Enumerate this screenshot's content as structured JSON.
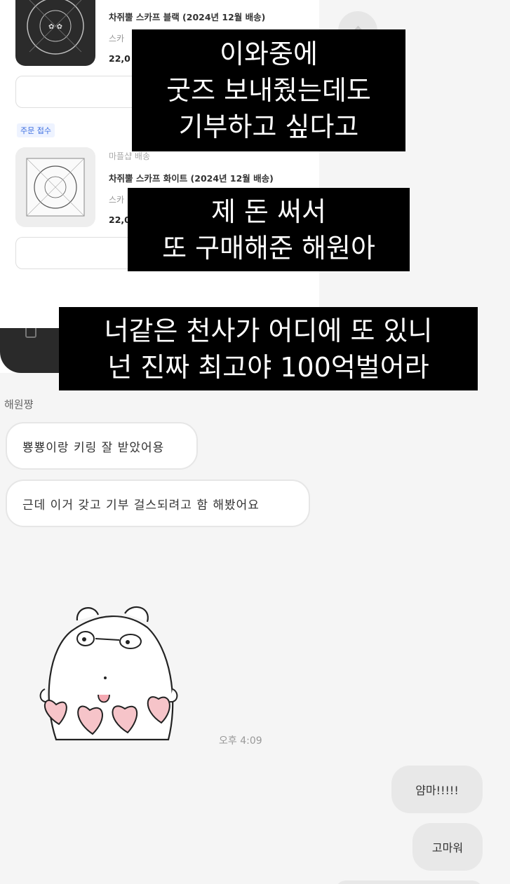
{
  "shop": {
    "order_status": "주문 접수",
    "products": [
      {
        "seller": "",
        "name": "차쥐뿔 스카프 블랙 (2024년 12월 배송)",
        "option": "스카",
        "price": "22,0",
        "thumb_color": "#2b2b2b"
      },
      {
        "seller": "마플샵 배송",
        "name": "차쥐뿔 스카프 화이트 (2024년 12월 배송)",
        "option": "스카",
        "price": "22,0",
        "thumb_color": "#f1f1f1"
      }
    ]
  },
  "captions": {
    "first": [
      "이와중에",
      "굿즈 보내줬는데도",
      "기부하고 싶다고"
    ],
    "second": [
      "제 돈 써서",
      "또 구매해준 해원아"
    ],
    "third": [
      "너같은 천사가 어디에 또 있니",
      "넌 진짜 최고야 100억벌어라"
    ]
  },
  "chat": {
    "sender_name": "해원쨩",
    "incoming": [
      "뿅뿅이랑 키링 잘 받았어용",
      "근데 이거 갖고 기부 걸스되려고 함 해봤어요"
    ],
    "sticker": "bear-hearts-sticker",
    "timestamp": "오후 4:09",
    "outgoing": [
      "얌마!!!!!",
      "고마워",
      ""
    ]
  },
  "colors": {
    "caption_bg": "#000000",
    "incoming_bubble": "#ffffff",
    "outgoing_bubble": "#e8e8e8",
    "badge_text": "#3d6fe0"
  }
}
